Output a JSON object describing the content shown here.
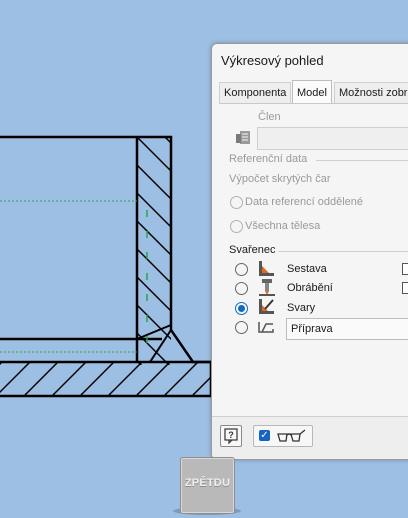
{
  "dialog": {
    "title": "Výkresový pohled",
    "tabs": [
      {
        "label": "Komponenta",
        "active": false
      },
      {
        "label": "Model",
        "active": true
      },
      {
        "label": "Možnosti zobra",
        "active": false
      }
    ],
    "member_label": "Člen",
    "reference_data_header": "Referenční data",
    "hidden_line_calc_label": "Výpočet skrytých čar",
    "reference_options": [
      {
        "label": "Data referencí oddělené",
        "selected": false,
        "enabled": false
      },
      {
        "label": "Všechna tělesa",
        "selected": false,
        "enabled": false
      }
    ],
    "weldment_header": "Svařenec",
    "weldment_options": [
      {
        "label": "Sestava",
        "icon": "assembly-weld-icon",
        "selected": false
      },
      {
        "label": "Obrábění",
        "icon": "machining-icon",
        "selected": false
      },
      {
        "label": "Svary",
        "icon": "welds-icon",
        "selected": true
      },
      {
        "label": "Příprava",
        "icon": "preparation-icon",
        "selected": false
      }
    ]
  },
  "footer": {
    "help_icon": "help-icon",
    "preview_checked": true,
    "preview_icon": "glasses-icon"
  },
  "back_button": {
    "label": "ZPĚTDU"
  },
  "colors": {
    "background": "#9dbfe3",
    "accent": "#0f6cbd",
    "drawing_line": "#000000",
    "hidden_line": "#22aa44"
  }
}
